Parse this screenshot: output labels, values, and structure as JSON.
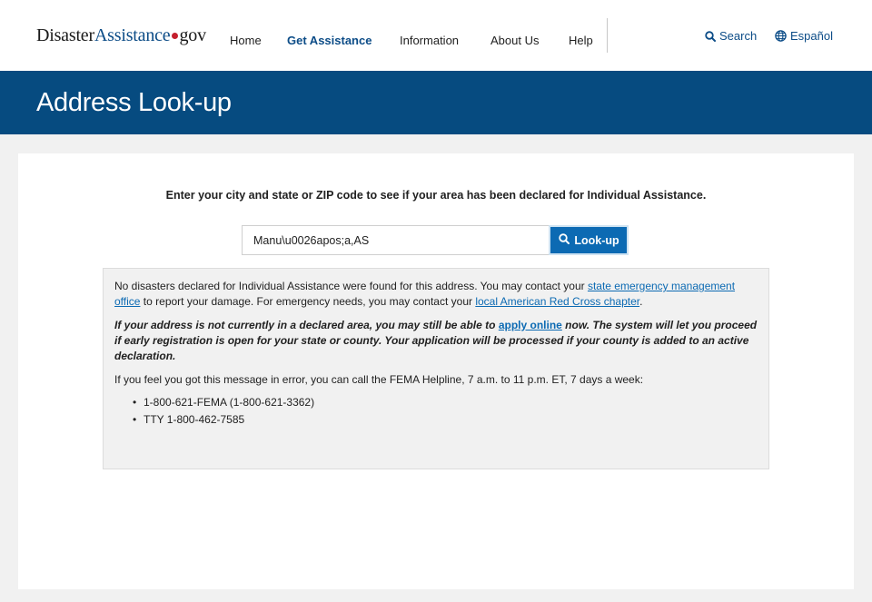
{
  "header": {
    "logo_part1": "Disaster",
    "logo_part2": "Assistance",
    "logo_part3": "gov",
    "nav": [
      "Home",
      "Get Assistance",
      "Information",
      "About Us",
      "Help"
    ],
    "active_nav": "Get Assistance",
    "search_label": "Search",
    "language_label": "Español"
  },
  "hero": {
    "title": "Address Look-up"
  },
  "main": {
    "instruction": "Enter your city and state or ZIP code to see if your area has been declared for Individual Assistance.",
    "search": {
      "value": "Manu\\u0026apos;a,AS",
      "button_label": "Look-up"
    },
    "result": {
      "p1_text1": "No disasters declared for Individual Assistance were found for this address. You may contact your ",
      "p1_link1": "state emergency management office",
      "p1_text2": " to report your damage. For emergency needs, you may contact your ",
      "p1_link2": "local American Red Cross chapter",
      "p1_text3": ".",
      "p2_text1": "If your address is not currently in a declared area, you may still be able to ",
      "p2_link": "apply online",
      "p2_text2": " now. The system will let you proceed if early registration is open for your state or county. Your application will be processed if your county is added to an active declaration.",
      "p3": "If you feel you got this message in error, you can call the FEMA Helpline, 7 a.m. to 11 p.m. ET, 7 days a week:",
      "phones": [
        "1-800-621-FEMA (1-800-621-3362)",
        "TTY 1-800-462-7585"
      ]
    }
  },
  "colors": {
    "brand_blue": "#064b80",
    "link_blue": "#0c6ab3",
    "logo_dot_red": "#c5202e"
  }
}
